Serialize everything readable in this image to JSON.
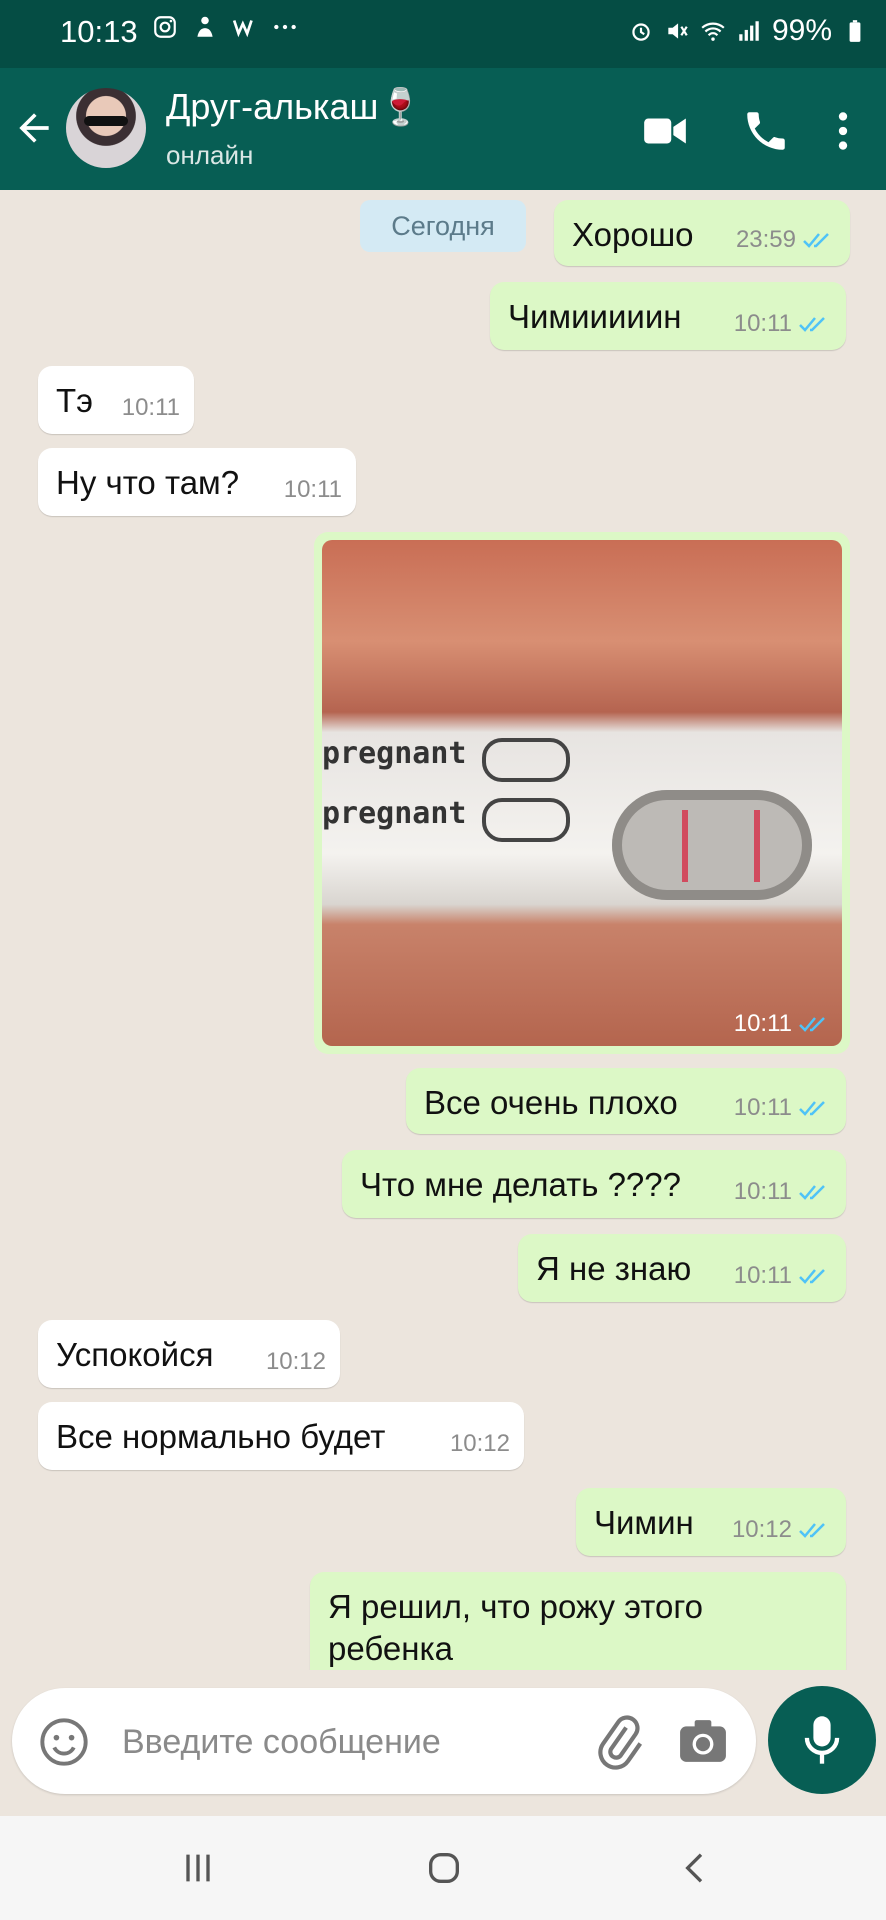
{
  "status_bar": {
    "time": "10:13",
    "battery": "99%",
    "left_icons": [
      "instagram-icon",
      "app-icon",
      "w-app-icon",
      "more-dots-icon"
    ],
    "right_icons": [
      "alarm-icon",
      "mute-icon",
      "wifi-icon",
      "signal-icon",
      "battery-icon"
    ]
  },
  "header": {
    "contact_name": "Друг-алькаш🍷",
    "status": "онлайн",
    "back_icon": "arrow-left-icon",
    "actions": [
      "video-call-icon",
      "phone-icon",
      "more-vert-icon"
    ]
  },
  "chat": {
    "date_label": "Сегодня",
    "messages": [
      {
        "dir": "out",
        "text": "Хорошо",
        "time": "23:59",
        "read": true
      },
      {
        "dir": "out",
        "text": "Чимииииин",
        "time": "10:11",
        "read": true
      },
      {
        "dir": "in",
        "text": "Тэ",
        "time": "10:11"
      },
      {
        "dir": "in",
        "text": "Ну что там?",
        "time": "10:11"
      },
      {
        "dir": "out",
        "type": "image",
        "time": "10:11",
        "read": true,
        "image_text": [
          "pregnant",
          "pregnant"
        ]
      },
      {
        "dir": "out",
        "text": "Все очень плохо",
        "time": "10:11",
        "read": true
      },
      {
        "dir": "out",
        "text": "Что мне делать ????",
        "time": "10:11",
        "read": true
      },
      {
        "dir": "out",
        "text": "Я не знаю",
        "time": "10:11",
        "read": true
      },
      {
        "dir": "in",
        "text": "Успокойся",
        "time": "10:12"
      },
      {
        "dir": "in",
        "text": "Все нормально будет",
        "time": "10:12"
      },
      {
        "dir": "out",
        "text": "Чимин",
        "time": "10:12",
        "read": true
      },
      {
        "dir": "out",
        "text": "Я решил, что рожу этого",
        "text2": "ребенка"
      }
    ]
  },
  "composer": {
    "placeholder": "Введите сообщение",
    "icons": [
      "emoji-icon",
      "attach-icon",
      "camera-icon",
      "mic-icon"
    ]
  },
  "colors": {
    "header": "#075e54",
    "status_bar": "#054d44",
    "outgoing": "#dcf8c6",
    "incoming": "#ffffff",
    "read_ticks": "#4fc3f7"
  }
}
